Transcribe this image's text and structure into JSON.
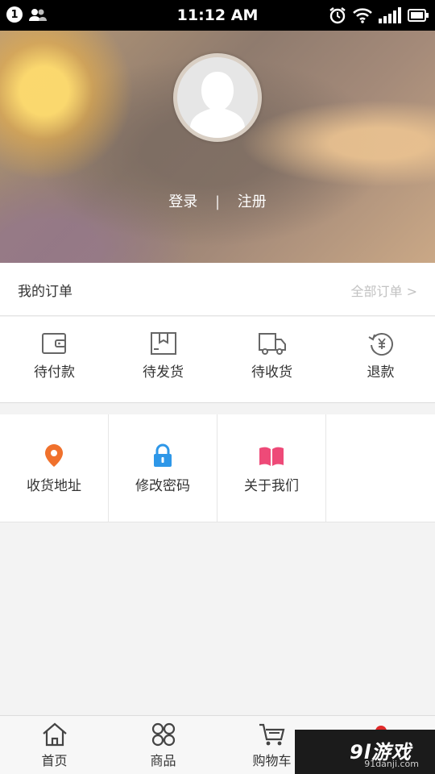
{
  "status_bar": {
    "time": "11:12 AM",
    "notification_count": "1"
  },
  "header": {
    "login_label": "登录",
    "separator": "|",
    "register_label": "注册"
  },
  "orders": {
    "title": "我的订单",
    "all_link": "全部订单 >",
    "statuses": [
      {
        "label": "待付款",
        "icon": "wallet-icon"
      },
      {
        "label": "待发货",
        "icon": "box-icon"
      },
      {
        "label": "待收货",
        "icon": "truck-icon"
      },
      {
        "label": "退款",
        "icon": "refund-icon"
      }
    ]
  },
  "tools": [
    {
      "label": "收货地址",
      "icon": "location-pin-icon",
      "color": "#f0712c"
    },
    {
      "label": "修改密码",
      "icon": "lock-icon",
      "color": "#2e97e8"
    },
    {
      "label": "关于我们",
      "icon": "book-icon",
      "color": "#ee4a78"
    }
  ],
  "tab_bar": {
    "items": [
      {
        "label": "首页",
        "icon": "home-icon"
      },
      {
        "label": "商品",
        "icon": "grid-icon"
      },
      {
        "label": "购物车",
        "icon": "cart-icon"
      }
    ]
  },
  "watermark": {
    "logo": "9l游戏",
    "url": "91danji.com"
  }
}
